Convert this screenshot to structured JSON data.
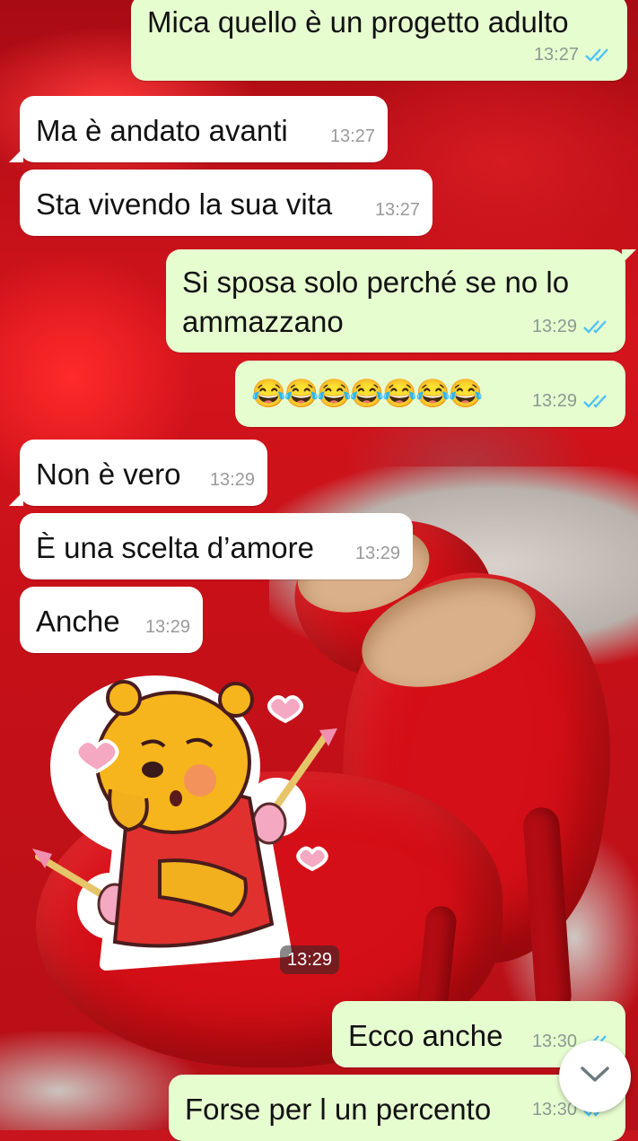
{
  "messages": [
    {
      "side": "out",
      "text": "Mica quello è un progetto adulto",
      "time": "13:27",
      "read": true
    },
    {
      "side": "in",
      "text": "Ma è andato avanti",
      "time": "13:27"
    },
    {
      "side": "in",
      "text": "Sta vivendo la sua vita",
      "time": "13:27"
    },
    {
      "side": "out",
      "text_line1": "Si sposa solo perché se no lo",
      "text_line2": "ammazzano",
      "time": "13:29",
      "read": true
    },
    {
      "side": "out",
      "text": "😂😂😂😂😂😂😂",
      "time": "13:29",
      "read": true
    },
    {
      "side": "in",
      "text": "Non è vero",
      "time": "13:29"
    },
    {
      "side": "in",
      "text": "È una scelta d’amore",
      "time": "13:29"
    },
    {
      "side": "in",
      "text": "Anche",
      "time": "13:29"
    },
    {
      "side": "in",
      "type": "sticker",
      "sticker": "winnie-pooh-cupid-icon",
      "time": "13:29"
    },
    {
      "side": "out",
      "text": "Ecco anche",
      "time": "13:30",
      "read": true
    },
    {
      "side": "out",
      "text": "Forse per l un percento",
      "time": "13:30",
      "read": true
    }
  ],
  "scroll_button": {
    "icon": "chevron-down-icon"
  },
  "colors": {
    "incoming_bubble": "#ffffff",
    "outgoing_bubble": "#e6fdd0",
    "read_check": "#4fc3f7",
    "wallpaper_accent": "#c8141c"
  }
}
